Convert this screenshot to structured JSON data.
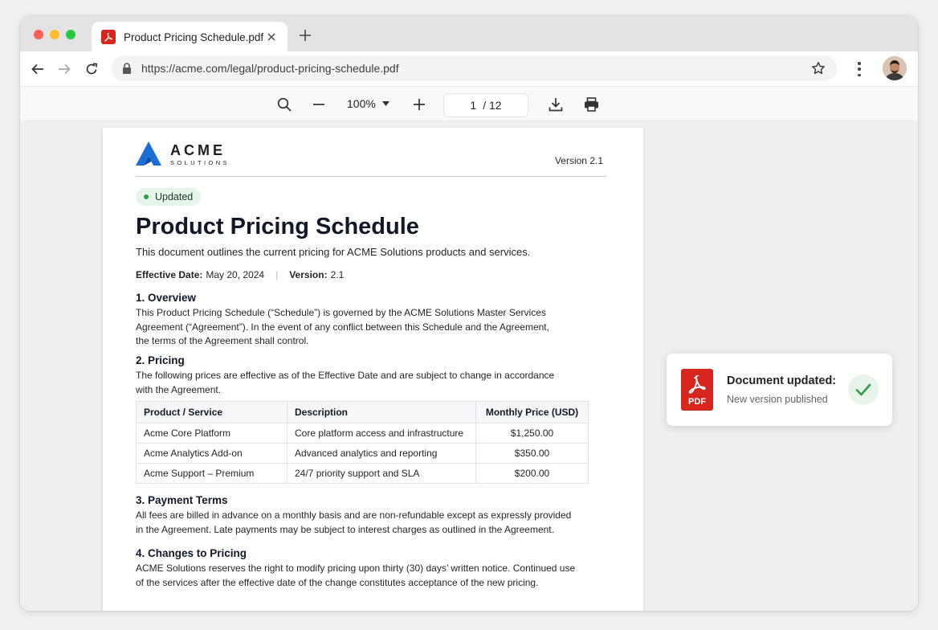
{
  "tab": {
    "title": "Product Pricing Schedule.pdf",
    "icon": "pdf-icon"
  },
  "address_bar": {
    "url": "https://acme.com/legal/product-pricing-schedule.pdf"
  },
  "pdf_toolbar": {
    "zoom": "100%",
    "current_page": "1",
    "total_pages": "/ 12"
  },
  "document": {
    "brand": {
      "name": "ACME",
      "sub": "SOLUTIONS"
    },
    "version_top": "Version 2.1",
    "badge": "Updated",
    "title": "Product Pricing Schedule",
    "intro": "This document outlines the current pricing for ACME Solutions products and services.",
    "meta": {
      "effective_label": "Effective Date:",
      "effective_value": "May 20, 2024",
      "separator": "|",
      "version_label": "Version:",
      "version_value": "2.1"
    },
    "sections": [
      {
        "heading": "1. Overview",
        "body": "This Product Pricing Schedule (“Schedule”) is governed by the ACME Solutions Master Services Agreement (“Agreement”). In the event of any conflict between this Schedule and the Agreement, the terms of the Agreement shall control."
      },
      {
        "heading": "2. Pricing",
        "body": "The following prices are effective as of the Effective Date and are subject to change in accordance with the Agreement."
      },
      {
        "heading": "3. Payment Terms",
        "body": "All fees are billed in advance on a monthly basis and are non-refundable except as expressly provided in the Agreement. Late payments may be subject to interest charges as outlined in the Agreement."
      },
      {
        "heading": "4. Changes to Pricing",
        "body": "ACME Solutions reserves the right to modify pricing upon thirty (30) days’ written notice. Continued use of the services after the effective date of the change constitutes acceptance of the new pricing."
      }
    ],
    "table": {
      "headers": [
        "Product / Service",
        "Description",
        "Monthly Price (USD)"
      ],
      "rows": [
        [
          "Acme Core Platform",
          "Core platform access and infrastructure",
          "$1,250.00"
        ],
        [
          "Acme Analytics Add-on",
          "Advanced analytics and reporting",
          "$350.00"
        ],
        [
          "Acme Support – Premium",
          "24/7 priority support and SLA",
          "$200.00"
        ]
      ]
    }
  },
  "toast": {
    "icon_label": "PDF",
    "title": "Document updated:",
    "subtitle": "New version published"
  },
  "colors": {
    "pdf_red": "#d7261d",
    "brand_blue": "#1a6fd6",
    "success_green": "#2e9c4d"
  }
}
